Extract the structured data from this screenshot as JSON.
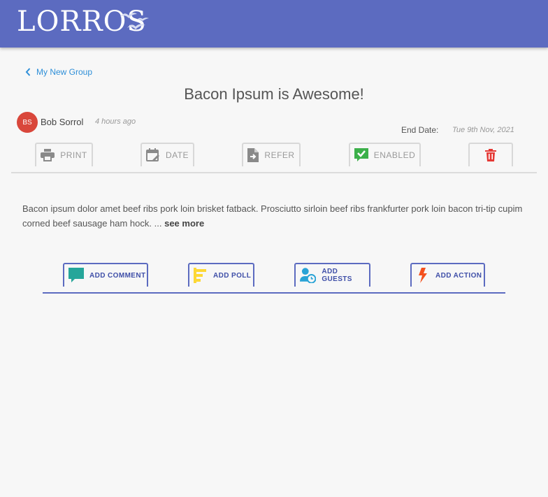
{
  "header": {
    "logo_text": "LORROS"
  },
  "nav": {
    "back_label": "My New Group"
  },
  "post": {
    "title": "Bacon Ipsum is Awesome!",
    "author_initials": "BS",
    "author_name": "Bob Sorrol",
    "time_ago": "4 hours ago",
    "end_date_label": "End Date:",
    "end_date_value": "Tue 9th Nov, 2021",
    "body": "Bacon ipsum dolor amet beef ribs pork loin brisket fatback. Prosciutto sirloin beef ribs frankfurter pork loin bacon tri-tip cupim corned beef sausage ham hock. ...",
    "see_more_label": "see more"
  },
  "toolbar": {
    "print_label": "PRINT",
    "date_label": "DATE",
    "refer_label": "REFER",
    "enabled_label": "ENABLED"
  },
  "actions": {
    "add_comment_label": "ADD COMMENT",
    "add_poll_label": "ADD POLL",
    "add_guests_label": "ADD GUESTS",
    "add_action_label": "ADD ACTION"
  },
  "icons": {
    "print": "print-icon",
    "date": "calendar-edit-icon",
    "refer": "file-forward-icon",
    "enabled": "checkbox-check-icon",
    "delete": "trash-icon",
    "comment": "comment-icon",
    "poll": "poll-icon",
    "guests": "user-clock-icon",
    "action": "lightning-icon"
  },
  "colors": {
    "brand": "#5c6bc0",
    "link": "#2e8fd8",
    "avatar": "#d9473b",
    "enabled_green": "#3cb04a",
    "delete_red": "#e53935",
    "comment_teal": "#26a69a",
    "poll_yellow": "#fdd835",
    "guests_blue": "#29a3d6",
    "action_orange": "#f4511e"
  }
}
